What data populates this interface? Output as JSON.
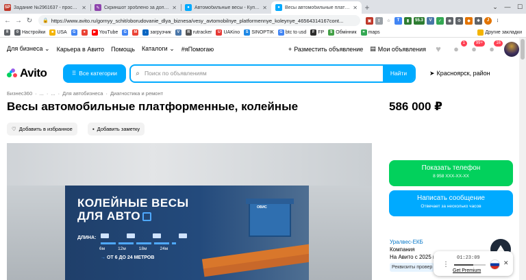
{
  "browser": {
    "tabs": [
      {
        "title": "Задание №2961637 - просмотр з",
        "fav": "SP",
        "fav_color": "#c0392b",
        "active": false
      },
      {
        "title": "Скриншот зроблено за допомогою",
        "fav": "",
        "fav_color": "#8e44ad",
        "active": false
      },
      {
        "title": "Автомобильные весы - Купить о",
        "fav": "",
        "fav_color": "#00aaff",
        "active": false
      },
      {
        "title": "Весы автомобильные платформ",
        "fav": "",
        "fav_color": "#00aaff",
        "active": true
      }
    ],
    "url": "https://www.avito.ru/gornyy_schit/oborudovanie_dlya_biznesa/vesy_avtomobilnye_platformennye_koleynye_46564314167cont...",
    "ltc_label": "LTC",
    "ltc_value": "55.3",
    "bookmarks": [
      "Настройки",
      "USA",
      "YouTube",
      "загрузчик",
      "rutracker",
      "UAKino",
      "SINOPTIK",
      "btc to usd",
      "FP",
      "Обмінник",
      "maps"
    ],
    "other_bookmarks": "Другие закладки"
  },
  "avito": {
    "top_links": [
      "Для бизнеса",
      "Карьера в Авито",
      "Помощь",
      "Каталоги",
      "#яПомогаю"
    ],
    "post_ad": "Разместить объявление",
    "my_ads": "Мои объявления",
    "badges": {
      "messages": "1",
      "notifications": "99+",
      "cart": "16"
    },
    "logo_text": "Avito",
    "categories_btn": "Все категории",
    "search_placeholder": "Поиск по объявлениям",
    "search_btn": "Найти",
    "region": "Красноярск, район"
  },
  "listing": {
    "breadcrumb": [
      "Бизнес360",
      "...",
      "...",
      "Для автобизнеса",
      "Диагностика и ремонт"
    ],
    "title": "Весы автомобильные платформенные, колейные",
    "price": "586 000 ₽",
    "favorite_btn": "Добавить в избранное",
    "note_btn": "Добавить заметку",
    "banner": {
      "headline_1": "КОЛЕЙНЫЕ ВЕСЫ",
      "headline_2": "ДЛЯ АВТО",
      "length_label": "ДЛИНА:",
      "sizes": [
        "6м",
        "12м",
        "18м",
        "24м"
      ],
      "range": "ОТ 6 ДО 24 МЕТРОВ",
      "booth_sign": "ОВИС"
    },
    "phone_btn": "Показать телефон",
    "phone_number": "8 958 XXX-XX-XX",
    "message_btn": "Написать сообщение",
    "message_sub": "Отвечает за несколько часов",
    "seller_name": "Уралвес-ЕКБ",
    "seller_type": "Компания",
    "seller_since": "На Авито с 2025 г.",
    "seller_req": "Реквизиты провер"
  },
  "overlay": {
    "time": "01:23:09",
    "premium": "Get Premium"
  }
}
